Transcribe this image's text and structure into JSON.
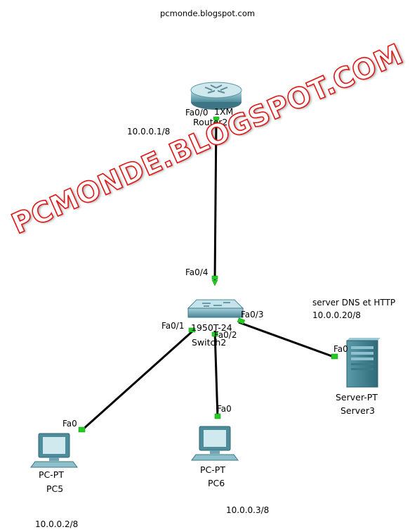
{
  "header": {
    "site": "pcmonde.blogspot.com"
  },
  "watermark": "PCMONDE.BLOGSPOT.COM",
  "devices": {
    "router": {
      "model": "1XM",
      "name": "Router2",
      "port": "Fa0/0"
    },
    "switch": {
      "model": "1950T-24",
      "name": "Switch2",
      "ports": {
        "up": "Fa0/4",
        "pc5": "Fa0/1",
        "pc6": "Fa0/2",
        "server": "Fa0/3"
      }
    },
    "server": {
      "model": "Server-PT",
      "name": "Server3",
      "port": "Fa0",
      "note": "server DNS et HTTP"
    },
    "pc5": {
      "model": "PC-PT",
      "name": "PC5",
      "port": "Fa0"
    },
    "pc6": {
      "model": "PC-PT",
      "name": "PC6",
      "port": "Fa0"
    }
  },
  "addresses": {
    "router": "10.0.0.1/8",
    "server": "10.0.0.20/8",
    "pc5": "10.0.0.2/8",
    "pc6": "10.0.0.3/8"
  },
  "colors": {
    "link": "#000000",
    "port_ok": "#22cc22",
    "watermark": "#e01818"
  }
}
